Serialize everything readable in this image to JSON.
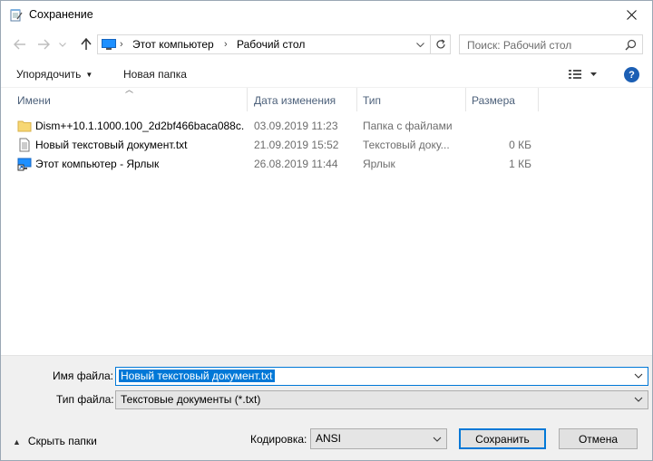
{
  "window": {
    "title": "Сохранение"
  },
  "address": {
    "crumbs": [
      "Этот компьютер",
      "Рабочий стол"
    ],
    "search_placeholder": "Поиск: Рабочий стол"
  },
  "toolbar": {
    "organize": "Упорядочить",
    "new_folder": "Новая папка",
    "help": "?"
  },
  "columns": {
    "name": "Имени",
    "date": "Дата изменения",
    "type": "Тип",
    "size": "Размера"
  },
  "files": [
    {
      "name": "Dism++10.1.1000.100_2d2bf466baca088c...",
      "date": "03.09.2019 11:23",
      "type": "Папка с файлами",
      "size": "",
      "icon": "folder-icon"
    },
    {
      "name": "Новый текстовый документ.txt",
      "date": "21.09.2019 15:52",
      "type": "Текстовый доку...",
      "size": "0 КБ",
      "icon": "text-file-icon"
    },
    {
      "name": "Этот компьютер - Ярлык",
      "date": "26.08.2019 11:44",
      "type": "Ярлык",
      "size": "1 КБ",
      "icon": "shortcut-icon"
    }
  ],
  "form": {
    "filename_label": "Имя файла:",
    "filename_value": "Новый текстовый документ.txt",
    "filetype_label": "Тип файла:",
    "filetype_value": "Текстовые документы (*.txt)",
    "encoding_label": "Кодировка:",
    "encoding_value": "ANSI"
  },
  "buttons": {
    "hide_folders": "Скрыть папки",
    "save": "Сохранить",
    "cancel": "Отмена"
  },
  "colors": {
    "accent": "#0078d7",
    "panel": "#f0f0f0",
    "header_text": "#4c607a",
    "folder": "#f7d774"
  }
}
